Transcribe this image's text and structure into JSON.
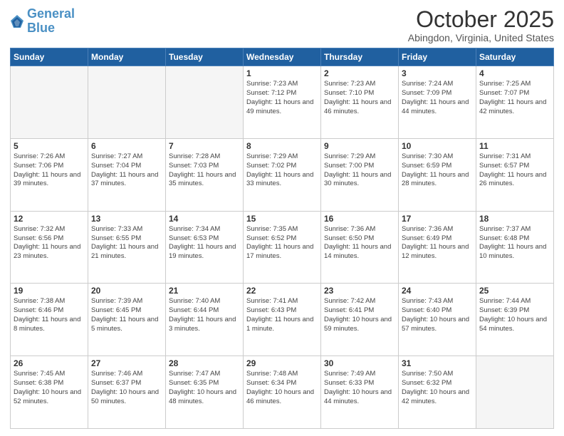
{
  "header": {
    "logo_general": "General",
    "logo_blue": "Blue",
    "month": "October 2025",
    "location": "Abingdon, Virginia, United States"
  },
  "weekdays": [
    "Sunday",
    "Monday",
    "Tuesday",
    "Wednesday",
    "Thursday",
    "Friday",
    "Saturday"
  ],
  "weeks": [
    [
      {
        "day": "",
        "info": ""
      },
      {
        "day": "",
        "info": ""
      },
      {
        "day": "",
        "info": ""
      },
      {
        "day": "1",
        "info": "Sunrise: 7:23 AM\nSunset: 7:12 PM\nDaylight: 11 hours\nand 49 minutes."
      },
      {
        "day": "2",
        "info": "Sunrise: 7:23 AM\nSunset: 7:10 PM\nDaylight: 11 hours\nand 46 minutes."
      },
      {
        "day": "3",
        "info": "Sunrise: 7:24 AM\nSunset: 7:09 PM\nDaylight: 11 hours\nand 44 minutes."
      },
      {
        "day": "4",
        "info": "Sunrise: 7:25 AM\nSunset: 7:07 PM\nDaylight: 11 hours\nand 42 minutes."
      }
    ],
    [
      {
        "day": "5",
        "info": "Sunrise: 7:26 AM\nSunset: 7:06 PM\nDaylight: 11 hours\nand 39 minutes."
      },
      {
        "day": "6",
        "info": "Sunrise: 7:27 AM\nSunset: 7:04 PM\nDaylight: 11 hours\nand 37 minutes."
      },
      {
        "day": "7",
        "info": "Sunrise: 7:28 AM\nSunset: 7:03 PM\nDaylight: 11 hours\nand 35 minutes."
      },
      {
        "day": "8",
        "info": "Sunrise: 7:29 AM\nSunset: 7:02 PM\nDaylight: 11 hours\nand 33 minutes."
      },
      {
        "day": "9",
        "info": "Sunrise: 7:29 AM\nSunset: 7:00 PM\nDaylight: 11 hours\nand 30 minutes."
      },
      {
        "day": "10",
        "info": "Sunrise: 7:30 AM\nSunset: 6:59 PM\nDaylight: 11 hours\nand 28 minutes."
      },
      {
        "day": "11",
        "info": "Sunrise: 7:31 AM\nSunset: 6:57 PM\nDaylight: 11 hours\nand 26 minutes."
      }
    ],
    [
      {
        "day": "12",
        "info": "Sunrise: 7:32 AM\nSunset: 6:56 PM\nDaylight: 11 hours\nand 23 minutes."
      },
      {
        "day": "13",
        "info": "Sunrise: 7:33 AM\nSunset: 6:55 PM\nDaylight: 11 hours\nand 21 minutes."
      },
      {
        "day": "14",
        "info": "Sunrise: 7:34 AM\nSunset: 6:53 PM\nDaylight: 11 hours\nand 19 minutes."
      },
      {
        "day": "15",
        "info": "Sunrise: 7:35 AM\nSunset: 6:52 PM\nDaylight: 11 hours\nand 17 minutes."
      },
      {
        "day": "16",
        "info": "Sunrise: 7:36 AM\nSunset: 6:50 PM\nDaylight: 11 hours\nand 14 minutes."
      },
      {
        "day": "17",
        "info": "Sunrise: 7:36 AM\nSunset: 6:49 PM\nDaylight: 11 hours\nand 12 minutes."
      },
      {
        "day": "18",
        "info": "Sunrise: 7:37 AM\nSunset: 6:48 PM\nDaylight: 11 hours\nand 10 minutes."
      }
    ],
    [
      {
        "day": "19",
        "info": "Sunrise: 7:38 AM\nSunset: 6:46 PM\nDaylight: 11 hours\nand 8 minutes."
      },
      {
        "day": "20",
        "info": "Sunrise: 7:39 AM\nSunset: 6:45 PM\nDaylight: 11 hours\nand 5 minutes."
      },
      {
        "day": "21",
        "info": "Sunrise: 7:40 AM\nSunset: 6:44 PM\nDaylight: 11 hours\nand 3 minutes."
      },
      {
        "day": "22",
        "info": "Sunrise: 7:41 AM\nSunset: 6:43 PM\nDaylight: 11 hours\nand 1 minute."
      },
      {
        "day": "23",
        "info": "Sunrise: 7:42 AM\nSunset: 6:41 PM\nDaylight: 10 hours\nand 59 minutes."
      },
      {
        "day": "24",
        "info": "Sunrise: 7:43 AM\nSunset: 6:40 PM\nDaylight: 10 hours\nand 57 minutes."
      },
      {
        "day": "25",
        "info": "Sunrise: 7:44 AM\nSunset: 6:39 PM\nDaylight: 10 hours\nand 54 minutes."
      }
    ],
    [
      {
        "day": "26",
        "info": "Sunrise: 7:45 AM\nSunset: 6:38 PM\nDaylight: 10 hours\nand 52 minutes."
      },
      {
        "day": "27",
        "info": "Sunrise: 7:46 AM\nSunset: 6:37 PM\nDaylight: 10 hours\nand 50 minutes."
      },
      {
        "day": "28",
        "info": "Sunrise: 7:47 AM\nSunset: 6:35 PM\nDaylight: 10 hours\nand 48 minutes."
      },
      {
        "day": "29",
        "info": "Sunrise: 7:48 AM\nSunset: 6:34 PM\nDaylight: 10 hours\nand 46 minutes."
      },
      {
        "day": "30",
        "info": "Sunrise: 7:49 AM\nSunset: 6:33 PM\nDaylight: 10 hours\nand 44 minutes."
      },
      {
        "day": "31",
        "info": "Sunrise: 7:50 AM\nSunset: 6:32 PM\nDaylight: 10 hours\nand 42 minutes."
      },
      {
        "day": "",
        "info": ""
      }
    ]
  ]
}
